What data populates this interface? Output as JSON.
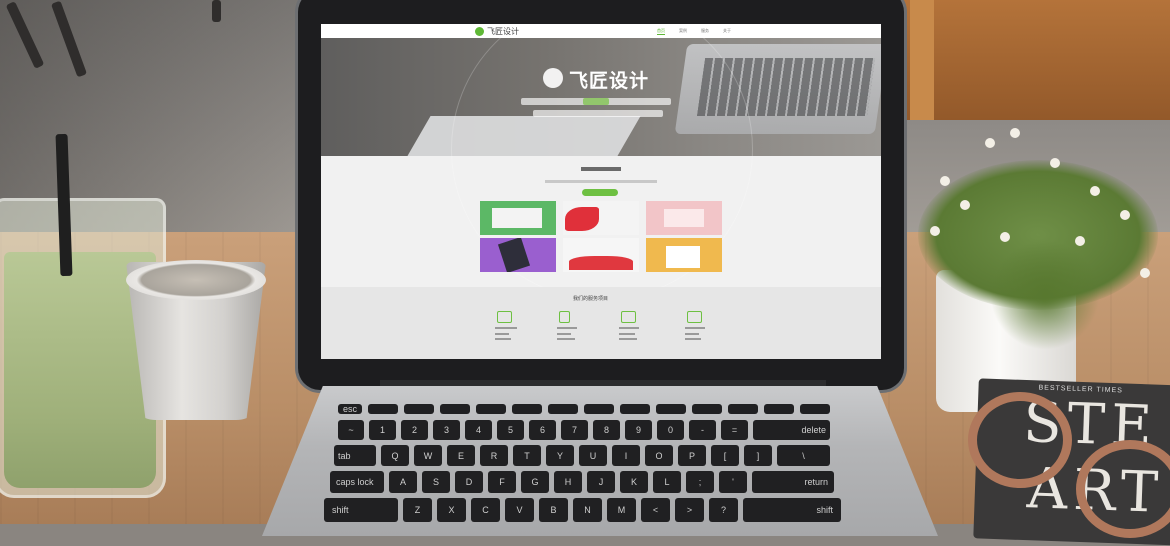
{
  "scene": {
    "book_text_line1": "STE",
    "book_text_line2": "ART",
    "book_small": "BESTSELLER TIMES"
  },
  "website": {
    "logo_text": "飞匠设计",
    "nav_items": [
      "首页",
      "案例",
      "服务",
      "关于"
    ],
    "hero_logo": "飞匠设计",
    "services_title": "我们的服务项目"
  },
  "keyboard": {
    "row2": [
      "~",
      "1",
      "2",
      "3",
      "4",
      "5",
      "6",
      "7",
      "8",
      "9",
      "0",
      "-",
      "=",
      "delete"
    ],
    "row3": [
      "tab",
      "Q",
      "W",
      "E",
      "R",
      "T",
      "Y",
      "U",
      "I",
      "O",
      "P",
      "[",
      "]",
      "\\"
    ],
    "row4": [
      "caps lock",
      "A",
      "S",
      "D",
      "F",
      "G",
      "H",
      "J",
      "K",
      "L",
      ";",
      "'",
      "return"
    ],
    "row5": [
      "shift",
      "Z",
      "X",
      "C",
      "V",
      "B",
      "N",
      "M",
      "<",
      ">",
      "?",
      "shift"
    ]
  },
  "colors": {
    "accent_green": "#6ec042",
    "screen_bg": "#f1f1f1",
    "laptop_bezel": "#1d1d1f"
  }
}
